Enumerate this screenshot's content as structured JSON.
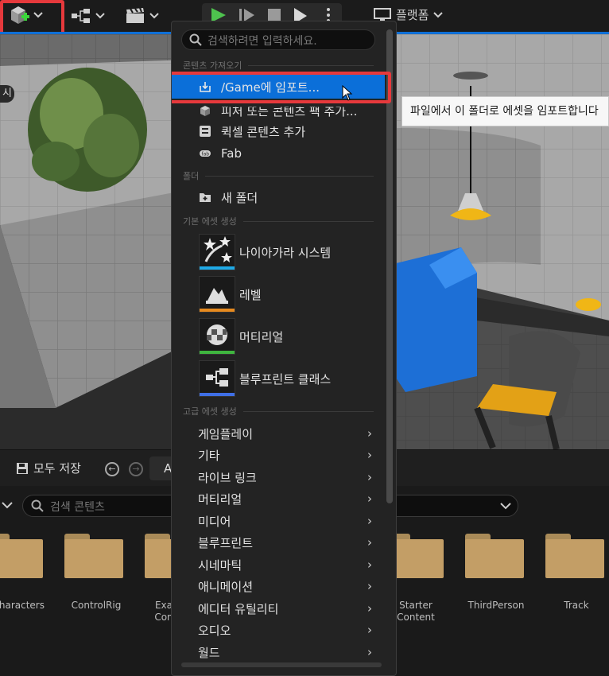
{
  "toolbar": {
    "platform_label": "플랫폼"
  },
  "viewport": {
    "side_label": "시"
  },
  "menu": {
    "search_placeholder": "검색하려면 입력하세요.",
    "section_get_content": "콘텐츠 가져오기",
    "import_label": "/Game에 임포트...",
    "feature_pack_label": "피처 또는 콘텐츠 팩 추가...",
    "quixel_label": "퀵셀 콘텐츠 추가",
    "fab_label": "Fab",
    "section_folder": "폴더",
    "new_folder_label": "새 폴더",
    "section_basic": "기본 에셋 생성",
    "basic_assets": [
      {
        "label": "나이아가라 시스템",
        "color": "#1fa9e6"
      },
      {
        "label": "레벨",
        "color": "#e68a1f"
      },
      {
        "label": "머티리얼",
        "color": "#3fb53f"
      },
      {
        "label": "블루프린트 클래스",
        "color": "#3f6fe6"
      }
    ],
    "section_advanced": "고급 에셋 생성",
    "advanced_items": [
      "게임플레이",
      "기타",
      "라이브 링크",
      "머티리얼",
      "미디어",
      "블루프린트",
      "시네마틱",
      "애니메이션",
      "에디터 유틸리티",
      "오디오",
      "월드"
    ]
  },
  "tooltip": {
    "text": "파일에서 이 폴더로 에셋을 임포트합니다"
  },
  "content_browser": {
    "save_all": "모두 저장",
    "path_text": "A",
    "search_placeholder": "검색 콘텐츠",
    "folders": [
      "haracters",
      "ControlRig",
      "Exa Con",
      "Starter Content",
      "ThirdPerson",
      "Track"
    ]
  },
  "colors": {
    "accent": "#0b6fd9",
    "highlight": "#e6393c",
    "folder": "#c39e66"
  }
}
